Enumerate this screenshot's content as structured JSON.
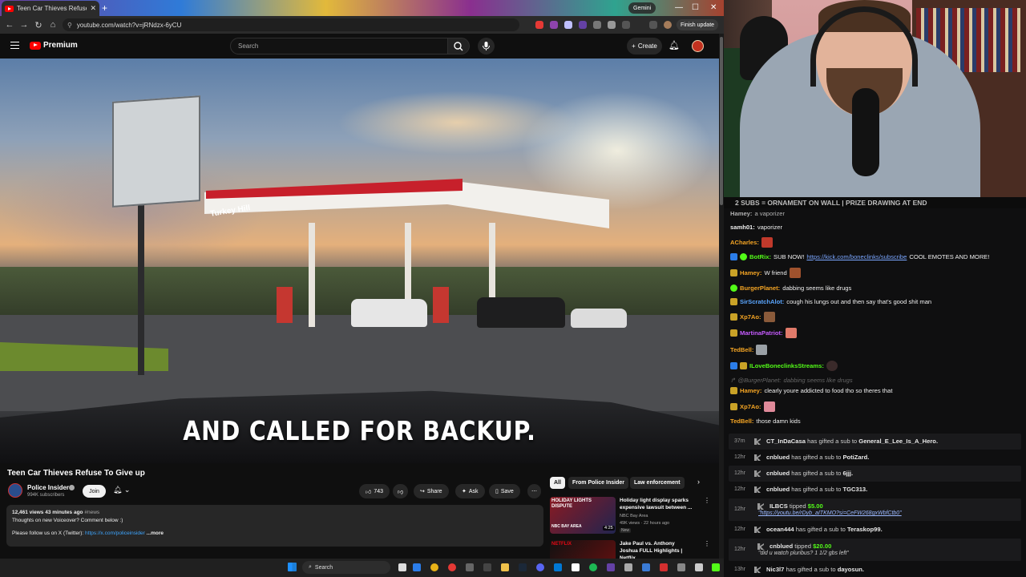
{
  "browser": {
    "tab_title": "Teen Car Thieves Refuse To Give",
    "new_tab": "+",
    "gemini_label": "Gemini",
    "url": "youtube.com/watch?v=jRNdzx-6yCU",
    "finish_update": "Finish update",
    "minimize": "—",
    "maximize": "☐",
    "close": "✕"
  },
  "youtube": {
    "logo": "Premium",
    "search_placeholder": "Search",
    "create_label": "Create",
    "video": {
      "caption": "AND CALLED FOR BACKUP.",
      "store_sign": "Turkey Hill"
    },
    "title": "Teen Car Thieves Refuse To Give up",
    "channel": {
      "name": "Police Insider",
      "subs": "994K subscribers",
      "join": "Join"
    },
    "actions": {
      "likes": "743",
      "share": "Share",
      "ask": "Ask",
      "save": "Save"
    },
    "description": {
      "meta": "12,461 views  43 minutes ago",
      "tag": "#news",
      "line1": "Thoughts on new Voiceover? Comment below :)",
      "line2": "Please follow us on X (Twitter):",
      "link": "https://x.com/policeinsider",
      "more": "...more"
    },
    "chips": [
      "All",
      "From Police Insider",
      "Law enforcement"
    ],
    "recommendations": [
      {
        "thumb_text": "HOLIDAY LIGHTS DISPUTE",
        "thumb_brand": "NBC BAY AREA",
        "duration": "4:25",
        "title": "Holiday light display sparks expensive lawsuit between ...",
        "channel": "NBC Bay Area",
        "views": "49K views · 22 hours ago",
        "badge": "New"
      },
      {
        "thumb_text": "NETFLIX",
        "title": "Jake Paul vs. Anthony Joshua FULL Highlights | Netflix",
        "channel": "",
        "views": ""
      }
    ]
  },
  "taskbar": {
    "search": "Search"
  },
  "stream": {
    "banner": "2 SUBS = ORNAMENT ON WALL | PRIZE DRAWING AT END",
    "chat": [
      {
        "user": "Hamey:",
        "text": "a vaporizer",
        "color": "#f1f1f1"
      },
      {
        "user": "samh01:",
        "text": "vaporizer",
        "color": "#f1f1f1"
      },
      {
        "user": "ACharles:",
        "text": "",
        "color": "#f5a524"
      },
      {
        "user": "BotRix:",
        "text": "SUB NOW!",
        "link": "https://kick.com/boneclinks/subscribe",
        "text2": "COOL EMOTES AND MORE!",
        "color": "#53fc18"
      },
      {
        "user": "Hamey:",
        "text": "W friend",
        "color": "#f5a524"
      },
      {
        "user": "BurgerPlanet:",
        "text": "dabbing seems like drugs",
        "color": "#f5a524"
      },
      {
        "user": "SirScratchAlot:",
        "text": "cough his lungs out and then say that's good shit man",
        "color": "#5aa6ff"
      },
      {
        "user": "Xp7Ao:",
        "text": "",
        "color": "#f5a524"
      },
      {
        "user": "MartinaPatriot:",
        "text": "",
        "color": "#c65bff"
      },
      {
        "user": "TedBell:",
        "text": "",
        "color": "#f5a524"
      },
      {
        "user": "ILoveBoneclinksStreams:",
        "text": "",
        "color": "#53fc18"
      },
      {
        "user": "@BurgerPlanet:",
        "text": "dabbing seems like drugs",
        "color": "#666"
      },
      {
        "user": "Hamey:",
        "text": "clearly youre addicted to food tho so theres that",
        "color": "#f5a524"
      },
      {
        "user": "Xp7Ao:",
        "text": "",
        "color": "#f5a524"
      },
      {
        "user": "TedBell:",
        "text": "those damn kids",
        "color": "#f5a524"
      }
    ],
    "events": [
      {
        "time": "37m",
        "user": "CT_InDaCasa",
        "text": "has gifted a sub to",
        "target": "General_E_Lee_Is_A_Hero."
      },
      {
        "time": "12hr",
        "user": "cnblued",
        "text": "has gifted a sub to",
        "target": "PotiZard."
      },
      {
        "time": "12hr",
        "user": "cnblued",
        "text": "has gifted a sub to",
        "target": "6jjj."
      },
      {
        "time": "12hr",
        "user": "cnblued",
        "text": "has gifted a sub to",
        "target": "TGC313."
      },
      {
        "time": "12hr",
        "user": "ILBCS",
        "text": "tipped",
        "amount": "$5.00",
        "note": "\"https://youtu.be/rDyb_aITKMO?si=CeFW268gxWbfCtb0\""
      },
      {
        "time": "12hr",
        "user": "ocean444",
        "text": "has gifted a sub to",
        "target": "Teraskop99."
      },
      {
        "time": "12hr",
        "user": "cnblued",
        "text": "tipped",
        "amount": "$20.00",
        "note": "\"did u watch pluribus? 1 1/2 gbs left\""
      },
      {
        "time": "13hr",
        "user": "Nic3l7",
        "text": "has gifted a sub to",
        "target": "dayosun."
      }
    ]
  }
}
